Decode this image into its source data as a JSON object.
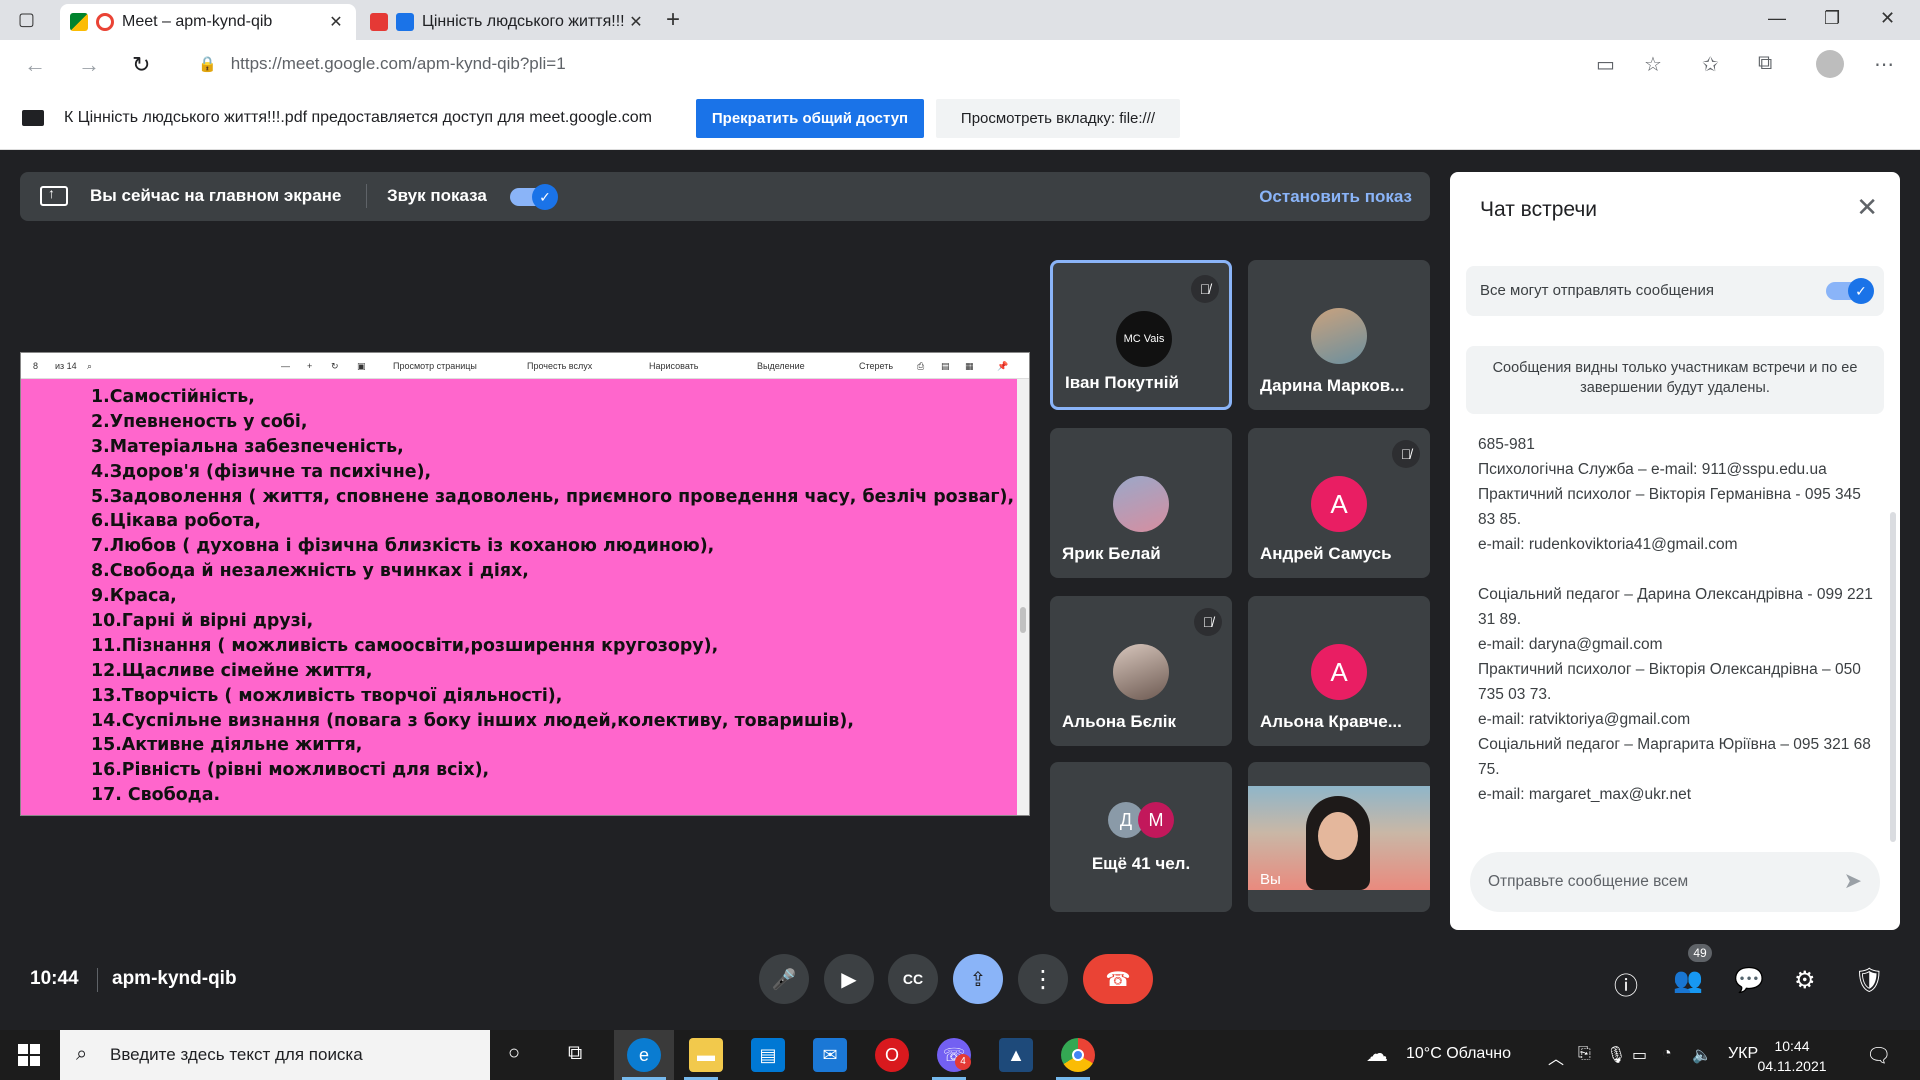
{
  "browser": {
    "tabs": [
      {
        "title": "Meet – apm-kynd-qib",
        "active": true
      },
      {
        "title": "Цінність людського життя!!!.pdf",
        "active": false
      }
    ],
    "url": "https://meet.google.com/apm-kynd-qib?pli=1",
    "infobar": {
      "message": "К Цінність людського життя!!!.pdf предоставляется доступ для meet.google.com",
      "stop_label": "Прекратить общий доступ",
      "view_label": "Просмотреть вкладку: file:///"
    }
  },
  "presenting": {
    "main_label": "Вы сейчас на главном экране",
    "sound_label": "Звук показа",
    "sound_on": true,
    "stop_label": "Остановить показ"
  },
  "pdf": {
    "page": "8",
    "of": "из 14",
    "toolbar": [
      "Просмотр страницы",
      "Прочесть вслух",
      "Нарисовать",
      "Выделение",
      "Стереть"
    ],
    "items": [
      "1.Самостійність,",
      "2.Упевненость у собі,",
      "3.Матеріальна забезпеченість,",
      "4.Здоров'я (фізичне та психічне),",
      "5.Задоволення ( життя, сповнене задоволень, приємного проведення часу, безліч розваг),",
      "6.Цікава робота,",
      "7.Любов ( духовна і фізична близкість із коханою людиною),",
      "8.Свобода й незалежність у вчинках і діях,",
      "9.Краса,",
      "10.Гарні й вірні друзі,",
      "11.Пізнання ( можливість самоосвіти,розширення кругозору),",
      "12.Щасливе сімейне життя,",
      "13.Творчість ( можливість творчої діяльності),",
      "14.Суспільне визнання (повага з боку інших людей,колективу, товаришів),",
      "15.Активне діяльне життя,",
      "16.Рівність (рівні можливості для всіх),",
      "17. Свобода."
    ]
  },
  "participants": [
    {
      "name": "Іван Покутній",
      "avatar": "MC Vais",
      "muted": true,
      "active": true
    },
    {
      "name": "Дарина Марков...",
      "avatar": "",
      "muted": false
    },
    {
      "name": "Ярик Белай",
      "avatar": "",
      "muted": false
    },
    {
      "name": "Андрей Самусь",
      "avatar": "А",
      "muted": true
    },
    {
      "name": "Альона Бєлік",
      "avatar": "",
      "muted": true
    },
    {
      "name": "Альона Кравче...",
      "avatar": "А",
      "muted": false
    },
    {
      "name": "Ещё 41 чел.",
      "initials": [
        "Д",
        "М"
      ]
    },
    {
      "name": "Вы"
    }
  ],
  "chat": {
    "title": "Чат встречи",
    "allow_label": "Все могут отправлять сообщения",
    "notice": "Сообщения видны только участникам встречи и по ее завершении будут удалены.",
    "messages": [
      "685-981",
      "Психологічна Служба – e-mail: 911@sspu.edu.ua",
      "Практичний психолог – Вікторія Германівна - 095 345 83 85.",
      "e-mail: rudenkoviktoria41@gmail.com",
      "",
      "Соціальний педагог – Дарина Олександрівна - 099 221 31 89.",
      "e-mail: daryna@gmail.com",
      "Практичний психолог – Вікторія Олександрівна – 050 735 03 73.",
      "e-mail: ratviktoriya@gmail.com",
      "Соціальний педагог – Маргарита Юріївна – 095 321 68 75.",
      "e-mail: margaret_max@ukr.net"
    ],
    "input_placeholder": "Отправьте сообщение всем"
  },
  "meeting": {
    "time": "10:44",
    "code": "apm-kynd-qib",
    "people_count": "49"
  },
  "taskbar": {
    "search_placeholder": "Введите здесь текст для поиска",
    "weather": "10°C  Облачно",
    "lang": "УКР",
    "time": "10:44",
    "date": "04.11.2021",
    "viber_badge": "4"
  },
  "colors": {
    "accent": "#1a73e8",
    "meet_bg": "#202124",
    "tile_bg": "#3c4043",
    "pdf_bg": "#ff66cc",
    "end_call": "#ea4335",
    "avatar_pink": "#e91e63"
  }
}
